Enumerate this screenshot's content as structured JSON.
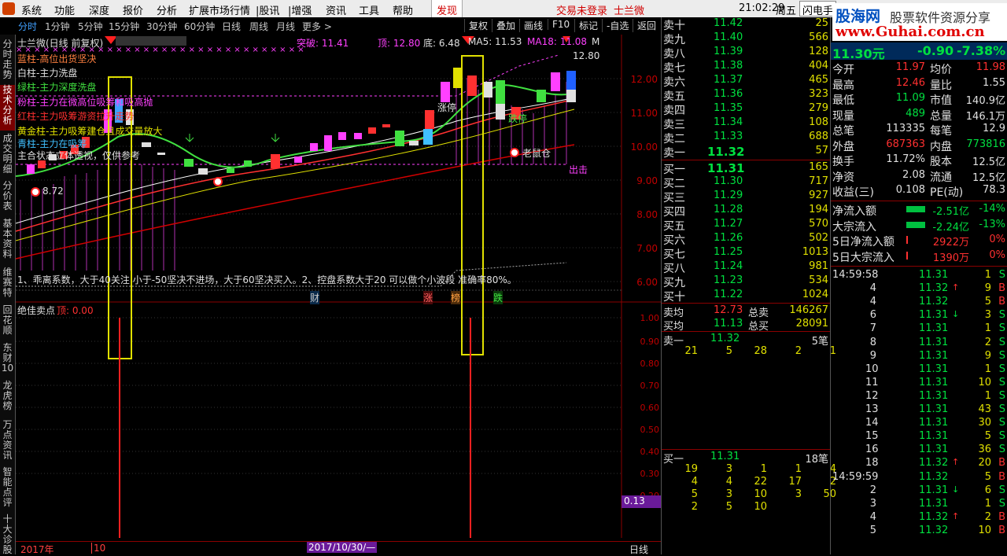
{
  "menu": {
    "items": [
      "系统",
      "功能",
      "深度",
      "报价",
      "分析",
      "扩展市场行情",
      "|股讯",
      "|增强",
      "资讯",
      "工具",
      "帮助"
    ],
    "discover": "发现",
    "login": "交易未登录",
    "stock": "士兰微",
    "time": "21:02:29",
    "weekday": "周五",
    "flash": "闪电手"
  },
  "banner": {
    "logo": "股海网",
    "slogan": "股票软件资源分享",
    "url": "www.Guhai.com.cn"
  },
  "tabs": {
    "periods": [
      "分时",
      "1分钟",
      "5分钟",
      "15分钟",
      "30分钟",
      "60分钟",
      "日线",
      "周线",
      "月线",
      "更多 >"
    ],
    "buttons": [
      "复权",
      "叠加",
      "画线",
      "F10",
      "标记",
      "-自选",
      "返回"
    ]
  },
  "leftnav": [
    "分时走势",
    "技术分析",
    "成交明细",
    "分价表",
    "基本资料",
    "维赛特",
    "回花顺",
    "东财10",
    "龙虎榜",
    "万点资讯",
    "智能点评",
    "十大诊股"
  ],
  "chart": {
    "title": "士兰微(日线 前复权)",
    "breakout": "突破: 11.41",
    "top": "顶: 12.80",
    "bottom": "底: 6.48",
    "ma5": "MA5: 11.53",
    "ma18": "MA18: 11.08",
    "m": "M",
    "legend": [
      {
        "text": "蓝柱-高位出货坚决",
        "color": "#ff8040"
      },
      {
        "text": "白柱-主力洗盘",
        "color": "#e0e0e0"
      },
      {
        "text": "绿柱-主力深度洗盘",
        "color": "#40e040"
      },
      {
        "text": "粉柱-主力在微高位吸筹和吸高抛",
        "color": "#ff40ff"
      },
      {
        "text": "红柱-主力吸筹游资拉升走势",
        "color": "#ff3030"
      },
      {
        "text": "黄金柱-主力吸筹建仓且成交量放大",
        "color": "#e0e000"
      },
      {
        "text": "青柱-主力在吸筹",
        "color": "#40c0ff"
      },
      {
        "text": "主合状态立体透视，仅供参考",
        "color": "#e0e0e0"
      }
    ],
    "note": "1、乖离系数，大于40关注 小于-50坚决不进场，大于60坚决买入。2、控盘系数大于20 可以做个小波段 准确率80%。",
    "labels": {
      "low": "8.72",
      "high": "12.80",
      "zhangting": "涨停",
      "dieting": "跌停",
      "laoshu": "老鼠仓",
      "chuji": "出击"
    },
    "yaxis": [
      "12.00",
      "11.00",
      "10.00",
      "9.00",
      "8.00",
      "7.00",
      "6.00"
    ],
    "markers": [
      {
        "text": "财",
        "color": "#40a0ff"
      },
      {
        "text": "涨",
        "color": "#ff4040"
      },
      {
        "text": "榜",
        "color": "#ffa040"
      },
      {
        "text": "跌",
        "color": "#40e040"
      }
    ],
    "sub_title": "绝佳卖点",
    "sub_value": "顶: 0.00",
    "sub_yaxis": [
      "1.00",
      "0.90",
      "0.80",
      "0.70",
      "0.60",
      "0.50",
      "0.40",
      "0.30",
      "0.20"
    ],
    "sub_box": "0.13",
    "date_left": "2017年",
    "date_mid": "10",
    "date_sel": "2017/10/30/—",
    "period": "日线"
  },
  "order": {
    "asks": [
      {
        "l": "卖十",
        "p": "11.42",
        "v": "25"
      },
      {
        "l": "卖九",
        "p": "11.40",
        "v": "566"
      },
      {
        "l": "卖八",
        "p": "11.39",
        "v": "128"
      },
      {
        "l": "卖七",
        "p": "11.38",
        "v": "404"
      },
      {
        "l": "卖六",
        "p": "11.37",
        "v": "465"
      },
      {
        "l": "卖五",
        "p": "11.36",
        "v": "323"
      },
      {
        "l": "卖四",
        "p": "11.35",
        "v": "279"
      },
      {
        "l": "卖三",
        "p": "11.34",
        "v": "108"
      },
      {
        "l": "卖二",
        "p": "11.33",
        "v": "688"
      },
      {
        "l": "卖一",
        "p": "11.32",
        "v": "57"
      }
    ],
    "bids": [
      {
        "l": "买一",
        "p": "11.31",
        "v": "165"
      },
      {
        "l": "买二",
        "p": "11.30",
        "v": "717"
      },
      {
        "l": "买三",
        "p": "11.29",
        "v": "927"
      },
      {
        "l": "买四",
        "p": "11.28",
        "v": "194"
      },
      {
        "l": "买五",
        "p": "11.27",
        "v": "570"
      },
      {
        "l": "买六",
        "p": "11.26",
        "v": "502"
      },
      {
        "l": "买七",
        "p": "11.25",
        "v": "1013"
      },
      {
        "l": "买八",
        "p": "11.24",
        "v": "981"
      },
      {
        "l": "买九",
        "p": "11.23",
        "v": "534"
      },
      {
        "l": "买十",
        "p": "11.22",
        "v": "1024"
      }
    ],
    "avg_sell_l": "卖均",
    "avg_sell": "12.73",
    "total_sell_l": "总卖",
    "total_sell": "146267",
    "avg_buy_l": "买均",
    "avg_buy": "11.13",
    "total_buy_l": "总买",
    "total_buy": "28091",
    "s1_l": "卖一",
    "s1_p": "11.32",
    "s1_c": "5笔",
    "s1_q": [
      "21",
      "5",
      "28",
      "2",
      "1"
    ],
    "b1_l": "买一",
    "b1_p": "11.31",
    "b1_c": "18笔",
    "b1_q": [
      [
        "19",
        "3",
        "1",
        "1",
        "4"
      ],
      [
        "4",
        "4",
        "22",
        "17",
        "2"
      ],
      [
        "5",
        "3",
        "10",
        "3",
        "50"
      ],
      [
        "2",
        "5",
        "10",
        "",
        ""
      ]
    ]
  },
  "quote": {
    "price": "11.30元",
    "chg": "-0.90",
    "pct": "-7.38%",
    "stats": [
      {
        "a": "今开",
        "av": "11.97",
        "b": "均价",
        "bv": "11.98",
        "ac": "r",
        "bc": "r"
      },
      {
        "a": "最高",
        "av": "12.46",
        "b": "量比",
        "bv": "1.55",
        "ac": "r",
        "bc": "w"
      },
      {
        "a": "最低",
        "av": "11.09",
        "b": "市值",
        "bv": "140.9亿",
        "ac": "g",
        "bc": "w"
      },
      {
        "a": "现量",
        "av": "489",
        "b": "总量",
        "bv": "146.1万",
        "ac": "g",
        "bc": "w"
      },
      {
        "a": "总笔",
        "av": "113335",
        "b": "每笔",
        "bv": "12.9",
        "ac": "w",
        "bc": "w"
      },
      {
        "a": "外盘",
        "av": "687363",
        "b": "内盘",
        "bv": "773816",
        "ac": "r",
        "bc": "g"
      },
      {
        "a": "换手",
        "av": "11.72%",
        "b": "股本",
        "bv": "12.5亿",
        "ac": "w",
        "bc": "w"
      },
      {
        "a": "净资",
        "av": "2.08",
        "b": "流通",
        "bv": "12.5亿",
        "ac": "w",
        "bc": "w"
      },
      {
        "a": "收益(三)",
        "av": "0.108",
        "b": "PE(动)",
        "bv": "78.3",
        "ac": "w",
        "bc": "w"
      }
    ],
    "flows": [
      {
        "l": "净流入额",
        "v": "-2.51亿",
        "p": "-14%",
        "c": "g"
      },
      {
        "l": "大宗流入",
        "v": "-2.24亿",
        "p": "-13%",
        "c": "g"
      },
      {
        "l": "5日净流入额",
        "v": "2922万",
        "p": "0%",
        "c": "r"
      },
      {
        "l": "5日大宗流入",
        "v": "1390万",
        "p": "0%",
        "c": "r"
      }
    ]
  },
  "ticks": [
    {
      "t": "14:59:58",
      "p": "11.31",
      "v": "1",
      "s": "S",
      "pc": "g",
      "sc": "g",
      "a": ""
    },
    {
      "t": "4",
      "p": "11.32",
      "v": "9",
      "s": "B",
      "pc": "g",
      "sc": "r",
      "a": "↑"
    },
    {
      "t": "4",
      "p": "11.32",
      "v": "5",
      "s": "B",
      "pc": "g",
      "sc": "r",
      "a": ""
    },
    {
      "t": "6",
      "p": "11.31",
      "v": "3",
      "s": "S",
      "pc": "g",
      "sc": "g",
      "a": "↓"
    },
    {
      "t": "7",
      "p": "11.31",
      "v": "1",
      "s": "S",
      "pc": "g",
      "sc": "g",
      "a": ""
    },
    {
      "t": "8",
      "p": "11.31",
      "v": "2",
      "s": "S",
      "pc": "g",
      "sc": "g",
      "a": ""
    },
    {
      "t": "9",
      "p": "11.31",
      "v": "9",
      "s": "S",
      "pc": "g",
      "sc": "g",
      "a": ""
    },
    {
      "t": "10",
      "p": "11.31",
      "v": "1",
      "s": "S",
      "pc": "g",
      "sc": "g",
      "a": ""
    },
    {
      "t": "11",
      "p": "11.31",
      "v": "10",
      "s": "S",
      "pc": "g",
      "sc": "g",
      "a": ""
    },
    {
      "t": "12",
      "p": "11.31",
      "v": "1",
      "s": "S",
      "pc": "g",
      "sc": "g",
      "a": ""
    },
    {
      "t": "13",
      "p": "11.31",
      "v": "43",
      "s": "S",
      "pc": "g",
      "sc": "g",
      "a": ""
    },
    {
      "t": "14",
      "p": "11.31",
      "v": "30",
      "s": "S",
      "pc": "g",
      "sc": "g",
      "a": ""
    },
    {
      "t": "15",
      "p": "11.31",
      "v": "5",
      "s": "S",
      "pc": "g",
      "sc": "g",
      "a": ""
    },
    {
      "t": "16",
      "p": "11.31",
      "v": "36",
      "s": "S",
      "pc": "g",
      "sc": "g",
      "a": ""
    },
    {
      "t": "18",
      "p": "11.32",
      "v": "20",
      "s": "B",
      "pc": "g",
      "sc": "r",
      "a": "↑"
    },
    {
      "t": "14:59:59",
      "p": "11.32",
      "v": "5",
      "s": "B",
      "pc": "g",
      "sc": "r",
      "a": ""
    },
    {
      "t": "2",
      "p": "11.31",
      "v": "6",
      "s": "S",
      "pc": "g",
      "sc": "g",
      "a": "↓"
    },
    {
      "t": "3",
      "p": "11.31",
      "v": "1",
      "s": "S",
      "pc": "g",
      "sc": "g",
      "a": ""
    },
    {
      "t": "4",
      "p": "11.32",
      "v": "2",
      "s": "B",
      "pc": "g",
      "sc": "r",
      "a": "↑"
    },
    {
      "t": "5",
      "p": "11.32",
      "v": "10",
      "s": "B",
      "pc": "g",
      "sc": "r",
      "a": ""
    }
  ]
}
